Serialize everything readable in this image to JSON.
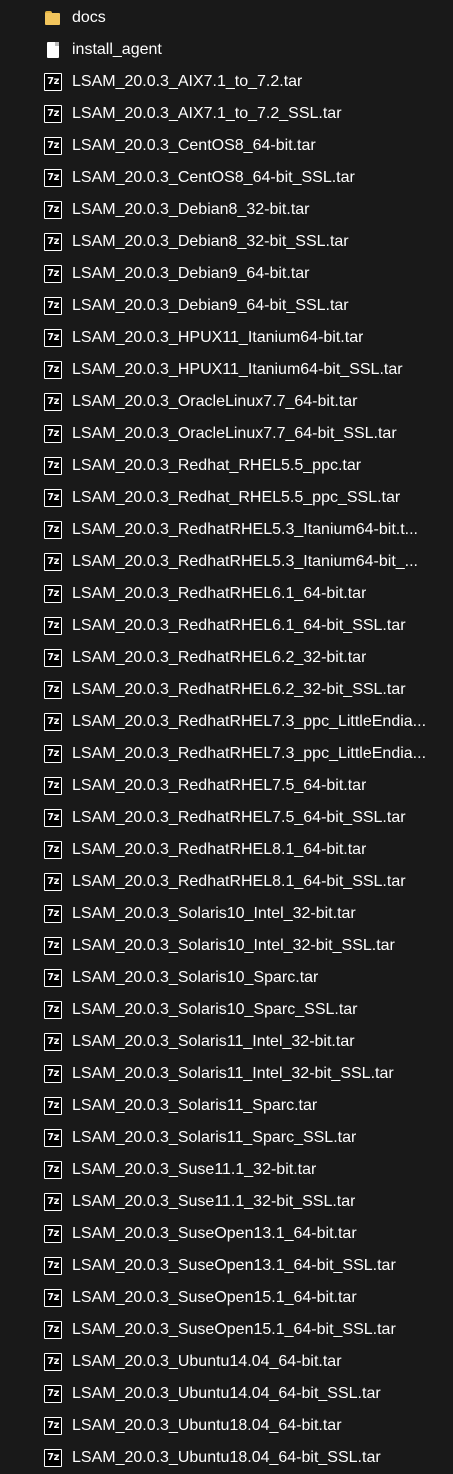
{
  "files": [
    {
      "name": "docs",
      "icon": "folder-icon"
    },
    {
      "name": "install_agent",
      "icon": "document-icon"
    },
    {
      "name": "LSAM_20.0.3_AIX7.1_to_7.2.tar",
      "icon": "7z-archive-icon"
    },
    {
      "name": "LSAM_20.0.3_AIX7.1_to_7.2_SSL.tar",
      "icon": "7z-archive-icon"
    },
    {
      "name": "LSAM_20.0.3_CentOS8_64-bit.tar",
      "icon": "7z-archive-icon"
    },
    {
      "name": "LSAM_20.0.3_CentOS8_64-bit_SSL.tar",
      "icon": "7z-archive-icon"
    },
    {
      "name": "LSAM_20.0.3_Debian8_32-bit.tar",
      "icon": "7z-archive-icon"
    },
    {
      "name": "LSAM_20.0.3_Debian8_32-bit_SSL.tar",
      "icon": "7z-archive-icon"
    },
    {
      "name": "LSAM_20.0.3_Debian9_64-bit.tar",
      "icon": "7z-archive-icon"
    },
    {
      "name": "LSAM_20.0.3_Debian9_64-bit_SSL.tar",
      "icon": "7z-archive-icon"
    },
    {
      "name": "LSAM_20.0.3_HPUX11_Itanium64-bit.tar",
      "icon": "7z-archive-icon"
    },
    {
      "name": "LSAM_20.0.3_HPUX11_Itanium64-bit_SSL.tar",
      "icon": "7z-archive-icon"
    },
    {
      "name": "LSAM_20.0.3_OracleLinux7.7_64-bit.tar",
      "icon": "7z-archive-icon"
    },
    {
      "name": "LSAM_20.0.3_OracleLinux7.7_64-bit_SSL.tar",
      "icon": "7z-archive-icon"
    },
    {
      "name": "LSAM_20.0.3_Redhat_RHEL5.5_ppc.tar",
      "icon": "7z-archive-icon"
    },
    {
      "name": "LSAM_20.0.3_Redhat_RHEL5.5_ppc_SSL.tar",
      "icon": "7z-archive-icon"
    },
    {
      "name": "LSAM_20.0.3_RedhatRHEL5.3_Itanium64-bit.t...",
      "icon": "7z-archive-icon"
    },
    {
      "name": "LSAM_20.0.3_RedhatRHEL5.3_Itanium64-bit_...",
      "icon": "7z-archive-icon"
    },
    {
      "name": "LSAM_20.0.3_RedhatRHEL6.1_64-bit.tar",
      "icon": "7z-archive-icon"
    },
    {
      "name": "LSAM_20.0.3_RedhatRHEL6.1_64-bit_SSL.tar",
      "icon": "7z-archive-icon"
    },
    {
      "name": "LSAM_20.0.3_RedhatRHEL6.2_32-bit.tar",
      "icon": "7z-archive-icon"
    },
    {
      "name": "LSAM_20.0.3_RedhatRHEL6.2_32-bit_SSL.tar",
      "icon": "7z-archive-icon"
    },
    {
      "name": "LSAM_20.0.3_RedhatRHEL7.3_ppc_LittleEndia...",
      "icon": "7z-archive-icon"
    },
    {
      "name": "LSAM_20.0.3_RedhatRHEL7.3_ppc_LittleEndia...",
      "icon": "7z-archive-icon"
    },
    {
      "name": "LSAM_20.0.3_RedhatRHEL7.5_64-bit.tar",
      "icon": "7z-archive-icon"
    },
    {
      "name": "LSAM_20.0.3_RedhatRHEL7.5_64-bit_SSL.tar",
      "icon": "7z-archive-icon"
    },
    {
      "name": "LSAM_20.0.3_RedhatRHEL8.1_64-bit.tar",
      "icon": "7z-archive-icon"
    },
    {
      "name": "LSAM_20.0.3_RedhatRHEL8.1_64-bit_SSL.tar",
      "icon": "7z-archive-icon"
    },
    {
      "name": "LSAM_20.0.3_Solaris10_Intel_32-bit.tar",
      "icon": "7z-archive-icon"
    },
    {
      "name": "LSAM_20.0.3_Solaris10_Intel_32-bit_SSL.tar",
      "icon": "7z-archive-icon"
    },
    {
      "name": "LSAM_20.0.3_Solaris10_Sparc.tar",
      "icon": "7z-archive-icon"
    },
    {
      "name": "LSAM_20.0.3_Solaris10_Sparc_SSL.tar",
      "icon": "7z-archive-icon"
    },
    {
      "name": "LSAM_20.0.3_Solaris11_Intel_32-bit.tar",
      "icon": "7z-archive-icon"
    },
    {
      "name": "LSAM_20.0.3_Solaris11_Intel_32-bit_SSL.tar",
      "icon": "7z-archive-icon"
    },
    {
      "name": "LSAM_20.0.3_Solaris11_Sparc.tar",
      "icon": "7z-archive-icon"
    },
    {
      "name": "LSAM_20.0.3_Solaris11_Sparc_SSL.tar",
      "icon": "7z-archive-icon"
    },
    {
      "name": "LSAM_20.0.3_Suse11.1_32-bit.tar",
      "icon": "7z-archive-icon"
    },
    {
      "name": "LSAM_20.0.3_Suse11.1_32-bit_SSL.tar",
      "icon": "7z-archive-icon"
    },
    {
      "name": "LSAM_20.0.3_SuseOpen13.1_64-bit.tar",
      "icon": "7z-archive-icon"
    },
    {
      "name": "LSAM_20.0.3_SuseOpen13.1_64-bit_SSL.tar",
      "icon": "7z-archive-icon"
    },
    {
      "name": "LSAM_20.0.3_SuseOpen15.1_64-bit.tar",
      "icon": "7z-archive-icon"
    },
    {
      "name": "LSAM_20.0.3_SuseOpen15.1_64-bit_SSL.tar",
      "icon": "7z-archive-icon"
    },
    {
      "name": "LSAM_20.0.3_Ubuntu14.04_64-bit.tar",
      "icon": "7z-archive-icon"
    },
    {
      "name": "LSAM_20.0.3_Ubuntu14.04_64-bit_SSL.tar",
      "icon": "7z-archive-icon"
    },
    {
      "name": "LSAM_20.0.3_Ubuntu18.04_64-bit.tar",
      "icon": "7z-archive-icon"
    },
    {
      "name": "LSAM_20.0.3_Ubuntu18.04_64-bit_SSL.tar",
      "icon": "7z-archive-icon"
    }
  ],
  "archive_badge": "7z"
}
